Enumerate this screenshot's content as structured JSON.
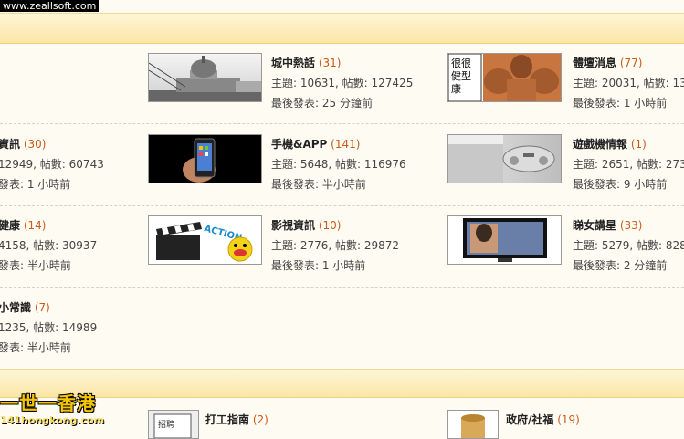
{
  "watermark": "www.zeallsoft.com",
  "logo": {
    "main": "一世一香港",
    "site": "141hongkong.com"
  },
  "forums": [
    {
      "name": "城中熱話",
      "count": "(31)",
      "topics": "主題: 10631, 帖數: 127425",
      "last": "最後發表: 25 分鐘前"
    },
    {
      "name": "體壇消息",
      "count": "(77)",
      "topics": "主題: 20031, 帖數: 13",
      "last": "最後發表: 1 小時前"
    },
    {
      "name": "資訊",
      "count": "(30)",
      "topics": "12949, 帖數: 60743",
      "last": "發表: 1 小時前"
    },
    {
      "name": "手機&APP",
      "count": "(141)",
      "topics": "主題: 5648, 帖數: 116976",
      "last": "最後發表: 半小時前"
    },
    {
      "name": "遊戲機情報",
      "count": "(1)",
      "topics": "主題: 2651, 帖數: 273",
      "last": "最後發表: 9 小時前"
    },
    {
      "name": "健康",
      "count": "(14)",
      "topics": "4158, 帖數: 30937",
      "last": "發表: 半小時前"
    },
    {
      "name": "影視資訊",
      "count": "(10)",
      "topics": "主題: 2776, 帖數: 29872",
      "last": "最後發表: 1 小時前"
    },
    {
      "name": "睇女講星",
      "count": "(33)",
      "topics": "主題: 5279, 帖數: 828",
      "last": "最後發表: 2 分鐘前"
    },
    {
      "name": "小常識",
      "count": "(7)",
      "topics": "1235, 帖數: 14989",
      "last": "發表: 半小時前"
    },
    {
      "name": "打工指南",
      "count": "(2)",
      "topics": "",
      "last": ""
    },
    {
      "name": "政府/社福",
      "count": "(19)",
      "topics": "",
      "last": ""
    }
  ],
  "thumbs": {
    "fitness_text": "很很健型康",
    "action_text": "ACTION",
    "job_text": "招聘"
  }
}
